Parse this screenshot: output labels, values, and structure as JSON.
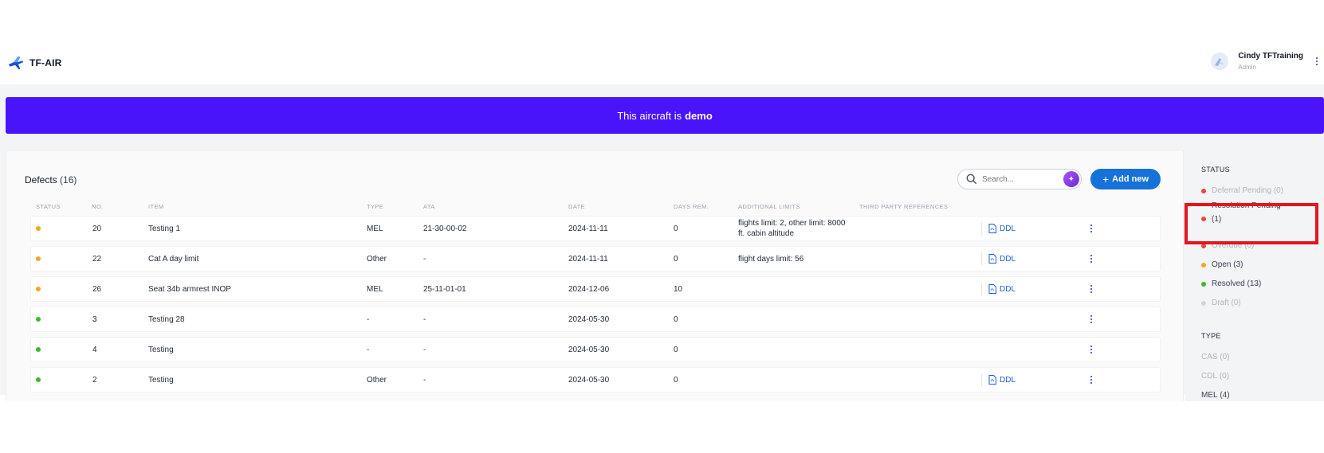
{
  "header": {
    "app_name": "TF-AIR",
    "user_name": "Cindy TFTraining",
    "user_role": "Admin"
  },
  "banner": {
    "prefix": "This aircraft is",
    "emphasis": "demo"
  },
  "defects": {
    "title": "Defects",
    "count": "(16)",
    "search_placeholder": "Search...",
    "add_label": "Add new",
    "columns": [
      "STATUS",
      "NO.",
      "ITEM",
      "TYPE",
      "ATA",
      "DATE",
      "DAYS REM.",
      "ADDITIONAL LIMITS",
      "THIRD PARTY REFERENCES"
    ],
    "rows": [
      {
        "status_color": "#f5a623",
        "no": "20",
        "item": "Testing 1",
        "type": "MEL",
        "ata": "21-30-00-02",
        "date": "2024-11-11",
        "days": "0",
        "limits_1": "flights limit: 2, other limit: 8000",
        "limits_2": "ft. cabin altitude",
        "ddl": "DDL"
      },
      {
        "status_color": "#f5a623",
        "no": "22",
        "item": "Cat A day limit",
        "type": "Other",
        "ata": "-",
        "date": "2024-11-11",
        "days": "0",
        "limits_1": "flight days limit: 56",
        "limits_2": "",
        "ddl": "DDL"
      },
      {
        "status_color": "#f5a623",
        "no": "26",
        "item": "Seat 34b armrest INOP",
        "type": "MEL",
        "ata": "25-11-01-01",
        "date": "2024-12-06",
        "days": "10",
        "limits_1": "",
        "limits_2": "",
        "ddl": "DDL"
      },
      {
        "status_color": "#3cb92f",
        "no": "3",
        "item": "Testing 28",
        "type": "-",
        "ata": "-",
        "date": "2024-05-30",
        "days": "0",
        "limits_1": "",
        "limits_2": "",
        "ddl": ""
      },
      {
        "status_color": "#3cb92f",
        "no": "4",
        "item": "Testing",
        "type": "-",
        "ata": "-",
        "date": "2024-05-30",
        "days": "0",
        "limits_1": "",
        "limits_2": "",
        "ddl": ""
      },
      {
        "status_color": "#3cb92f",
        "no": "2",
        "item": "Testing",
        "type": "Other",
        "ata": "-",
        "date": "2024-05-30",
        "days": "0",
        "limits_1": "",
        "limits_2": "",
        "ddl": "DDL"
      }
    ]
  },
  "sidebar": {
    "status_heading": "STATUS",
    "status_items": [
      {
        "label": "Deferral Pending",
        "count": "(0)",
        "color": "#e84545"
      },
      {
        "label": "Resolution Pending",
        "count": "(1)",
        "color": "#e84545"
      },
      {
        "label": "Overdue",
        "count": "(0)",
        "color": "#e84545"
      },
      {
        "label": "Open",
        "count": "(3)",
        "color": "#f5a623"
      },
      {
        "label": "Resolved",
        "count": "(13)",
        "color": "#3cb92f"
      },
      {
        "label": "Draft",
        "count": "(0)",
        "color": "#d1d5db"
      }
    ],
    "type_heading": "TYPE",
    "type_items": [
      {
        "label": "CAS",
        "count": "(0)"
      },
      {
        "label": "CDL",
        "count": "(0)"
      },
      {
        "label": "MEL",
        "count": "(4)"
      }
    ]
  }
}
